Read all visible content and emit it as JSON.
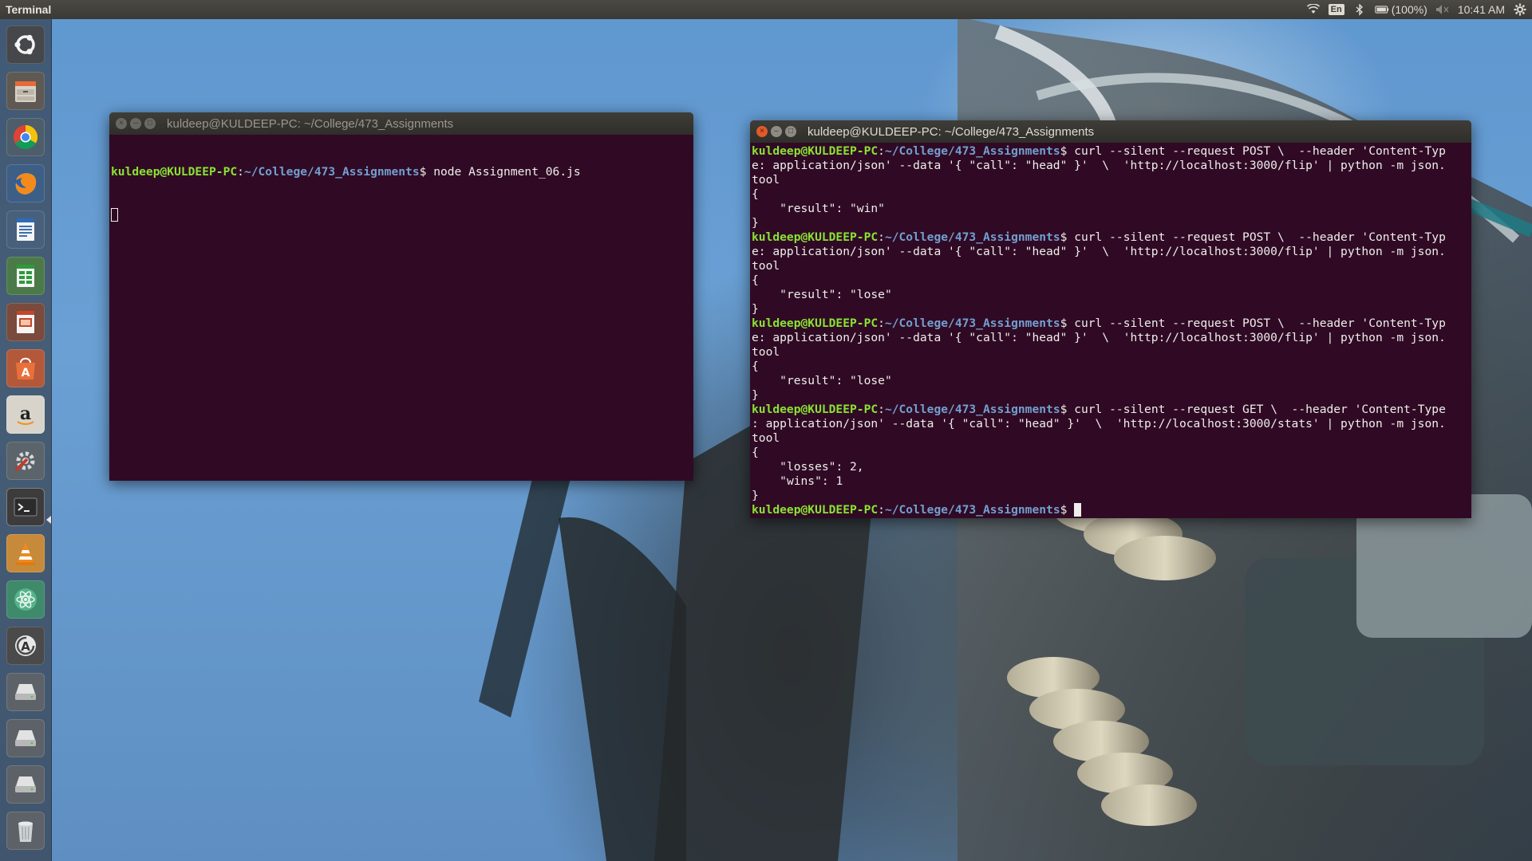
{
  "topbar": {
    "app_title": "Terminal",
    "keyboard_layout": "En",
    "battery": "(100%)",
    "clock": "10:41 AM",
    "icons": [
      "wifi-icon",
      "keyboard-layout-icon",
      "bluetooth-icon",
      "battery-icon",
      "volume-muted-icon",
      "settings-gear-icon"
    ]
  },
  "launcher": {
    "items": [
      {
        "name": "ubuntu-dash",
        "icon": "ubuntu-logo-icon"
      },
      {
        "name": "files",
        "icon": "file-cabinet-icon"
      },
      {
        "name": "chrome",
        "icon": "chrome-icon"
      },
      {
        "name": "firefox",
        "icon": "firefox-icon"
      },
      {
        "name": "libreoffice-writer",
        "icon": "writer-document-icon"
      },
      {
        "name": "libreoffice-calc",
        "icon": "calc-spreadsheet-icon"
      },
      {
        "name": "libreoffice-impress",
        "icon": "impress-presentation-icon"
      },
      {
        "name": "software-center",
        "icon": "shopping-bag-icon"
      },
      {
        "name": "amazon",
        "icon": "amazon-icon"
      },
      {
        "name": "system-settings",
        "icon": "settings-tools-icon"
      },
      {
        "name": "terminal",
        "icon": "terminal-icon"
      },
      {
        "name": "vlc",
        "icon": "vlc-cone-icon"
      },
      {
        "name": "atom",
        "icon": "atom-icon"
      },
      {
        "name": "software-updater",
        "icon": "updater-icon"
      },
      {
        "name": "drive-1",
        "icon": "hard-drive-icon"
      },
      {
        "name": "drive-2",
        "icon": "hard-drive-icon"
      },
      {
        "name": "drive-3",
        "icon": "hard-drive-icon"
      },
      {
        "name": "trash",
        "icon": "trash-icon"
      }
    ]
  },
  "left_window": {
    "title": "kuldeep@KULDEEP-PC: ~/College/473_Assignments",
    "prompt_user": "kuldeep@KULDEEP-PC",
    "prompt_colon": ":",
    "prompt_path": "~/College/473_Assignments",
    "prompt_dollar": "$ ",
    "command": "node Assignment_06.js"
  },
  "right_window": {
    "title": "kuldeep@KULDEEP-PC: ~/College/473_Assignments",
    "prompt_user": "kuldeep@KULDEEP-PC",
    "prompt_colon": ":",
    "prompt_path": "~/College/473_Assignments",
    "prompt_dollar": "$ ",
    "blocks": [
      {
        "command_lines": [
          "curl --silent --request POST \\  --header 'Content-Typ",
          "e: application/json' --data '{ \"call\": \"head\" }'  \\  'http://localhost:3000/flip' | python -m json.",
          "tool"
        ],
        "output": [
          "{",
          "    \"result\": \"win\"",
          "}"
        ]
      },
      {
        "command_lines": [
          "curl --silent --request POST \\  --header 'Content-Typ",
          "e: application/json' --data '{ \"call\": \"head\" }'  \\  'http://localhost:3000/flip' | python -m json.",
          "tool"
        ],
        "output": [
          "{",
          "    \"result\": \"lose\"",
          "}"
        ]
      },
      {
        "command_lines": [
          "curl --silent --request POST \\  --header 'Content-Typ",
          "e: application/json' --data '{ \"call\": \"head\" }'  \\  'http://localhost:3000/flip' | python -m json.",
          "tool"
        ],
        "output": [
          "{",
          "    \"result\": \"lose\"",
          "}"
        ]
      },
      {
        "command_lines": [
          "curl --silent --request GET \\  --header 'Content-Type",
          ": application/json' --data '{ \"call\": \"head\" }'  \\  'http://localhost:3000/stats' | python -m json.",
          "tool"
        ],
        "output": [
          "{",
          "    \"losses\": 2,",
          "    \"wins\": 1",
          "}"
        ]
      }
    ]
  },
  "colors": {
    "terminal_bg": "#300a24",
    "prompt_user": "#8ae234",
    "prompt_path": "#729fcf",
    "close_button": "#e05a2a"
  }
}
